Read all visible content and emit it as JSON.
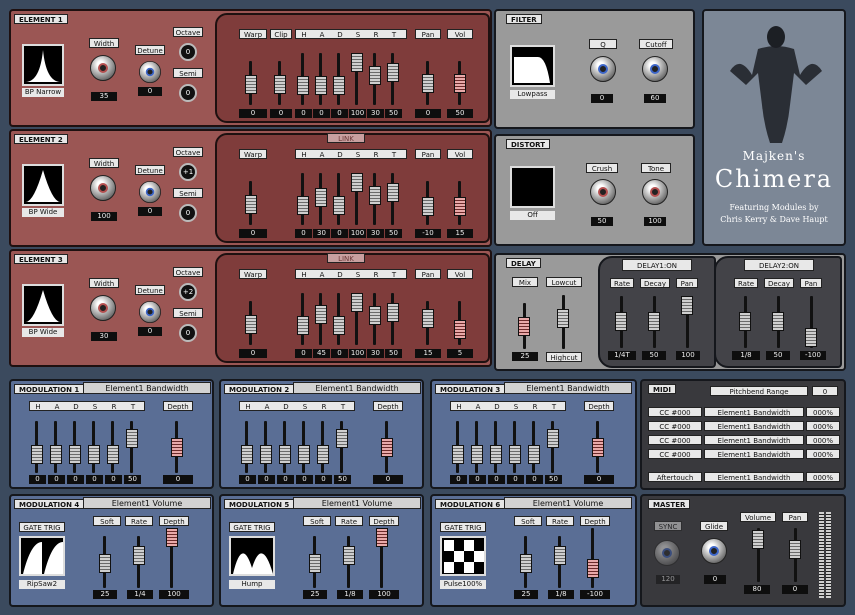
{
  "app": {
    "title_line1": "Majken's",
    "title_line2": "Chimera",
    "title_line3": "Featuring Modules by",
    "title_line4": "Chris Kerry & Dave Haupt"
  },
  "labels": {
    "width": "Width",
    "detune": "Detune",
    "octave": "Octave",
    "semi": "Semi",
    "warp": "Warp",
    "clip": "Clip",
    "h": "H",
    "a": "A",
    "d": "D",
    "s": "S",
    "r": "R",
    "t": "T",
    "pan": "Pan",
    "vol": "Vol",
    "link": "LINK",
    "q": "Q",
    "cutoff": "Cutoff",
    "crush": "Crush",
    "tone": "Tone",
    "mix": "Mix",
    "lowcut": "Lowcut",
    "highcut": "Highcut",
    "rate": "Rate",
    "decay": "Decay",
    "depth": "Depth",
    "soft": "Soft",
    "gate_trig": "GATE TRIG",
    "pitchbend": "Pitchbend Range",
    "pitchbend_val": "0",
    "sync": "SYNC",
    "glide": "Glide",
    "volume": "Volume",
    "aftertouch": "Aftertouch"
  },
  "elements": [
    {
      "tag": "ELEMENT 1",
      "wave": "BP Narrow",
      "width": "35",
      "detune": "0",
      "octave": "0",
      "semi": "0",
      "warp": "0",
      "clip": "0",
      "hadsrt": [
        "0",
        "0",
        "0",
        "100",
        "30",
        "50"
      ],
      "pan": "0",
      "vol": "50"
    },
    {
      "tag": "ELEMENT 2",
      "wave": "BP Wide",
      "width": "100",
      "detune": "0",
      "octave": "+1",
      "semi": "0",
      "warp": "0",
      "clip": "",
      "hadsrt": [
        "0",
        "30",
        "0",
        "100",
        "30",
        "50"
      ],
      "pan": "-10",
      "vol": "15"
    },
    {
      "tag": "ELEMENT 3",
      "wave": "BP Wide",
      "width": "30",
      "detune": "0",
      "octave": "+2",
      "semi": "0",
      "warp": "0",
      "clip": "",
      "hadsrt": [
        "0",
        "45",
        "0",
        "100",
        "30",
        "50"
      ],
      "pan": "15",
      "vol": "5"
    }
  ],
  "filter": {
    "tag": "FILTER",
    "type": "Lowpass",
    "q": "0",
    "cutoff": "60"
  },
  "distort": {
    "tag": "DISTORT",
    "type": "Off",
    "crush": "50",
    "tone": "100"
  },
  "delay": {
    "tag": "DELAY",
    "mix": "25",
    "on1": "DELAY1:ON",
    "on2": "DELAY2:ON",
    "d1": {
      "rate": "1/4T",
      "decay": "50",
      "pan": "100"
    },
    "d2": {
      "rate": "1/8",
      "decay": "50",
      "pan": "-100"
    }
  },
  "modulation": [
    {
      "tag": "MODULATION 1",
      "target": "Element1 Bandwidth",
      "vals": [
        "0",
        "0",
        "0",
        "0",
        "0",
        "50"
      ],
      "depth": "0"
    },
    {
      "tag": "MODULATION 2",
      "target": "Element1 Bandwidth",
      "vals": [
        "0",
        "0",
        "0",
        "0",
        "0",
        "50"
      ],
      "depth": "0"
    },
    {
      "tag": "MODULATION 3",
      "target": "Element1 Bandwidth",
      "vals": [
        "0",
        "0",
        "0",
        "0",
        "0",
        "50"
      ],
      "depth": "0"
    },
    {
      "tag": "MODULATION 4",
      "target": "Element1 Volume",
      "shape": "RipSaw2",
      "soft": "25",
      "rate": "1/4",
      "depth": "100"
    },
    {
      "tag": "MODULATION 5",
      "target": "Element1 Volume",
      "shape": "Hump",
      "soft": "25",
      "rate": "1/8",
      "depth": "100"
    },
    {
      "tag": "MODULATION 6",
      "target": "Element1 Volume",
      "shape": "Pulse100%",
      "soft": "25",
      "rate": "1/8",
      "depth": "-100"
    }
  ],
  "midi": {
    "tag": "MIDI",
    "rows": [
      {
        "cc": "CC #000",
        "target": "Element1 Bandwidth",
        "amt": "000%"
      },
      {
        "cc": "CC #000",
        "target": "Element1 Bandwidth",
        "amt": "000%"
      },
      {
        "cc": "CC #000",
        "target": "Element1 Bandwidth",
        "amt": "000%"
      },
      {
        "cc": "CC #000",
        "target": "Element1 Bandwidth",
        "amt": "000%"
      }
    ],
    "aftertouch_target": "Element1 Bandwidth",
    "aftertouch_amt": "000%"
  },
  "master": {
    "tag": "MASTER",
    "sync_val": "120",
    "glide": "0",
    "volume": "80",
    "pan": "0"
  }
}
